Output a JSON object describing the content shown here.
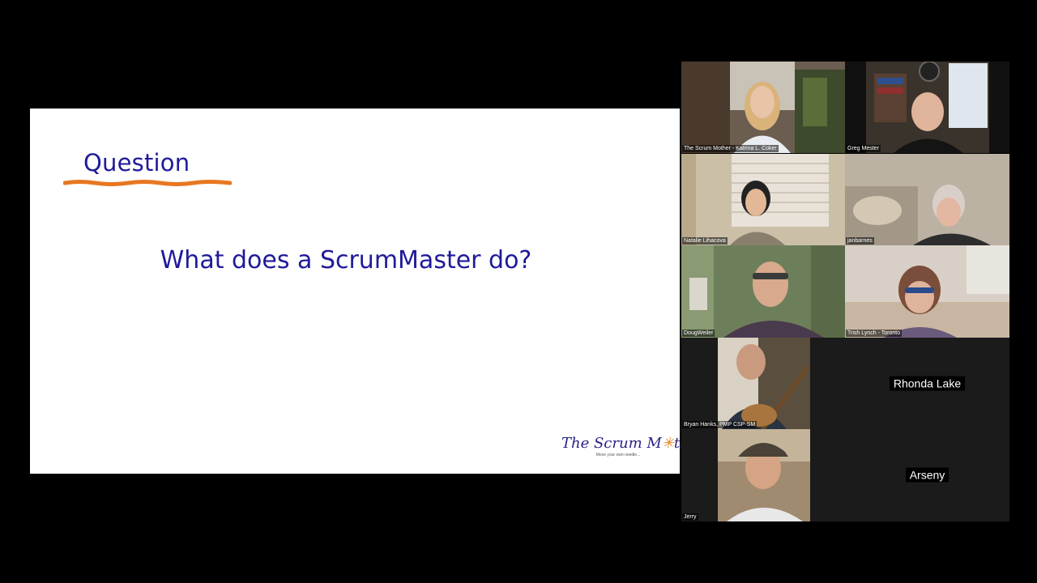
{
  "slide": {
    "title": "Question",
    "question": "What does a ScrumMaster do?",
    "logo": {
      "text_before": "The Scrum M",
      "star": "✳",
      "text_after": "ther",
      "tagline": "Move your own needle..."
    },
    "colors": {
      "text": "#1f1a9a",
      "underline": "#e87722"
    }
  },
  "participants": [
    {
      "name": "The Scrum Mother - Katrina L. Coker",
      "video": true
    },
    {
      "name": "Greg Mester",
      "video": true
    },
    {
      "name": "Natalie Lihacova",
      "video": true
    },
    {
      "name": "janbarnes",
      "video": true
    },
    {
      "name": "DougWeiler",
      "video": true
    },
    {
      "name": "Trish Lynch - Toronto",
      "video": true
    },
    {
      "name": "Bryan Hanks, PMP CSP-SM",
      "video": true
    },
    {
      "name": "Rhonda Lake",
      "video": false
    },
    {
      "name": "Jerry",
      "video": true
    },
    {
      "name": "Arseny",
      "video": false
    }
  ]
}
